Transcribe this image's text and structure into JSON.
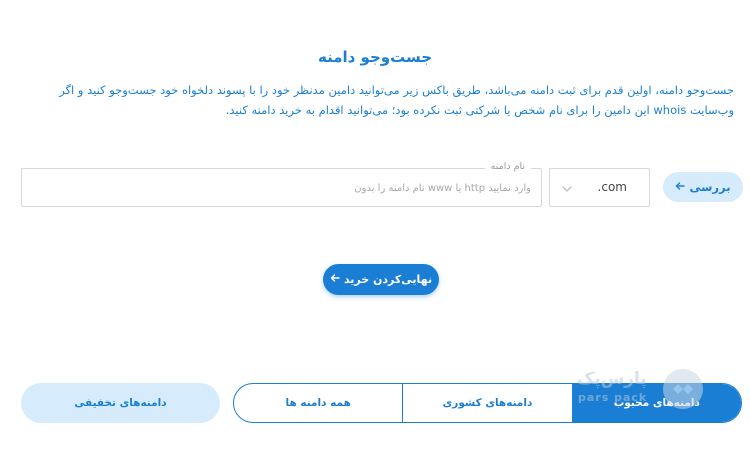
{
  "search": {
    "title": "جست‌وجو دامنه",
    "description": "جست‌وجو دامنه، اولین قدم برای ثبت دامنه می‌باشد، طریق باکس زیر می‌توانید دامین مدنظر خود را با پسوند دلخواه خود جست‌وجو کنید و اگر وب‌سایت whois این دامین را برای نام شخص یا شرکتی ثبت نکرده بود؛ می‌توانید اقدام به خرید دامنه کنید.",
    "check_button": "بررسی",
    "tld_selected": ".com",
    "domain_label": "نام دامنه",
    "domain_value": "",
    "domain_placeholder": "وارد نمایید http یا www نام دامنه را بدون"
  },
  "finalize_button": "نهایی‌کردن خرید",
  "categories": {
    "tabs": [
      {
        "label": "دامنه‌های محبوب",
        "active": true
      },
      {
        "label": "دامنه‌های کشوری",
        "active": false
      },
      {
        "label": "همه دامنه ها",
        "active": false
      }
    ],
    "discount_button": "دامنه‌های تخفیفی"
  },
  "watermark": {
    "text_fa": "پارس‌پک",
    "text_en": "pars pack"
  },
  "colors": {
    "accent": "#1a7fd4",
    "accent_light": "#d6ebfb",
    "border": "#d8d8d8"
  },
  "icons": {
    "check_arrow": "arrow-left-icon",
    "finalize_arrow": "arrow-left-icon",
    "tld_dropdown": "chevron-down-icon",
    "watermark_logo": "parspack-logo"
  }
}
